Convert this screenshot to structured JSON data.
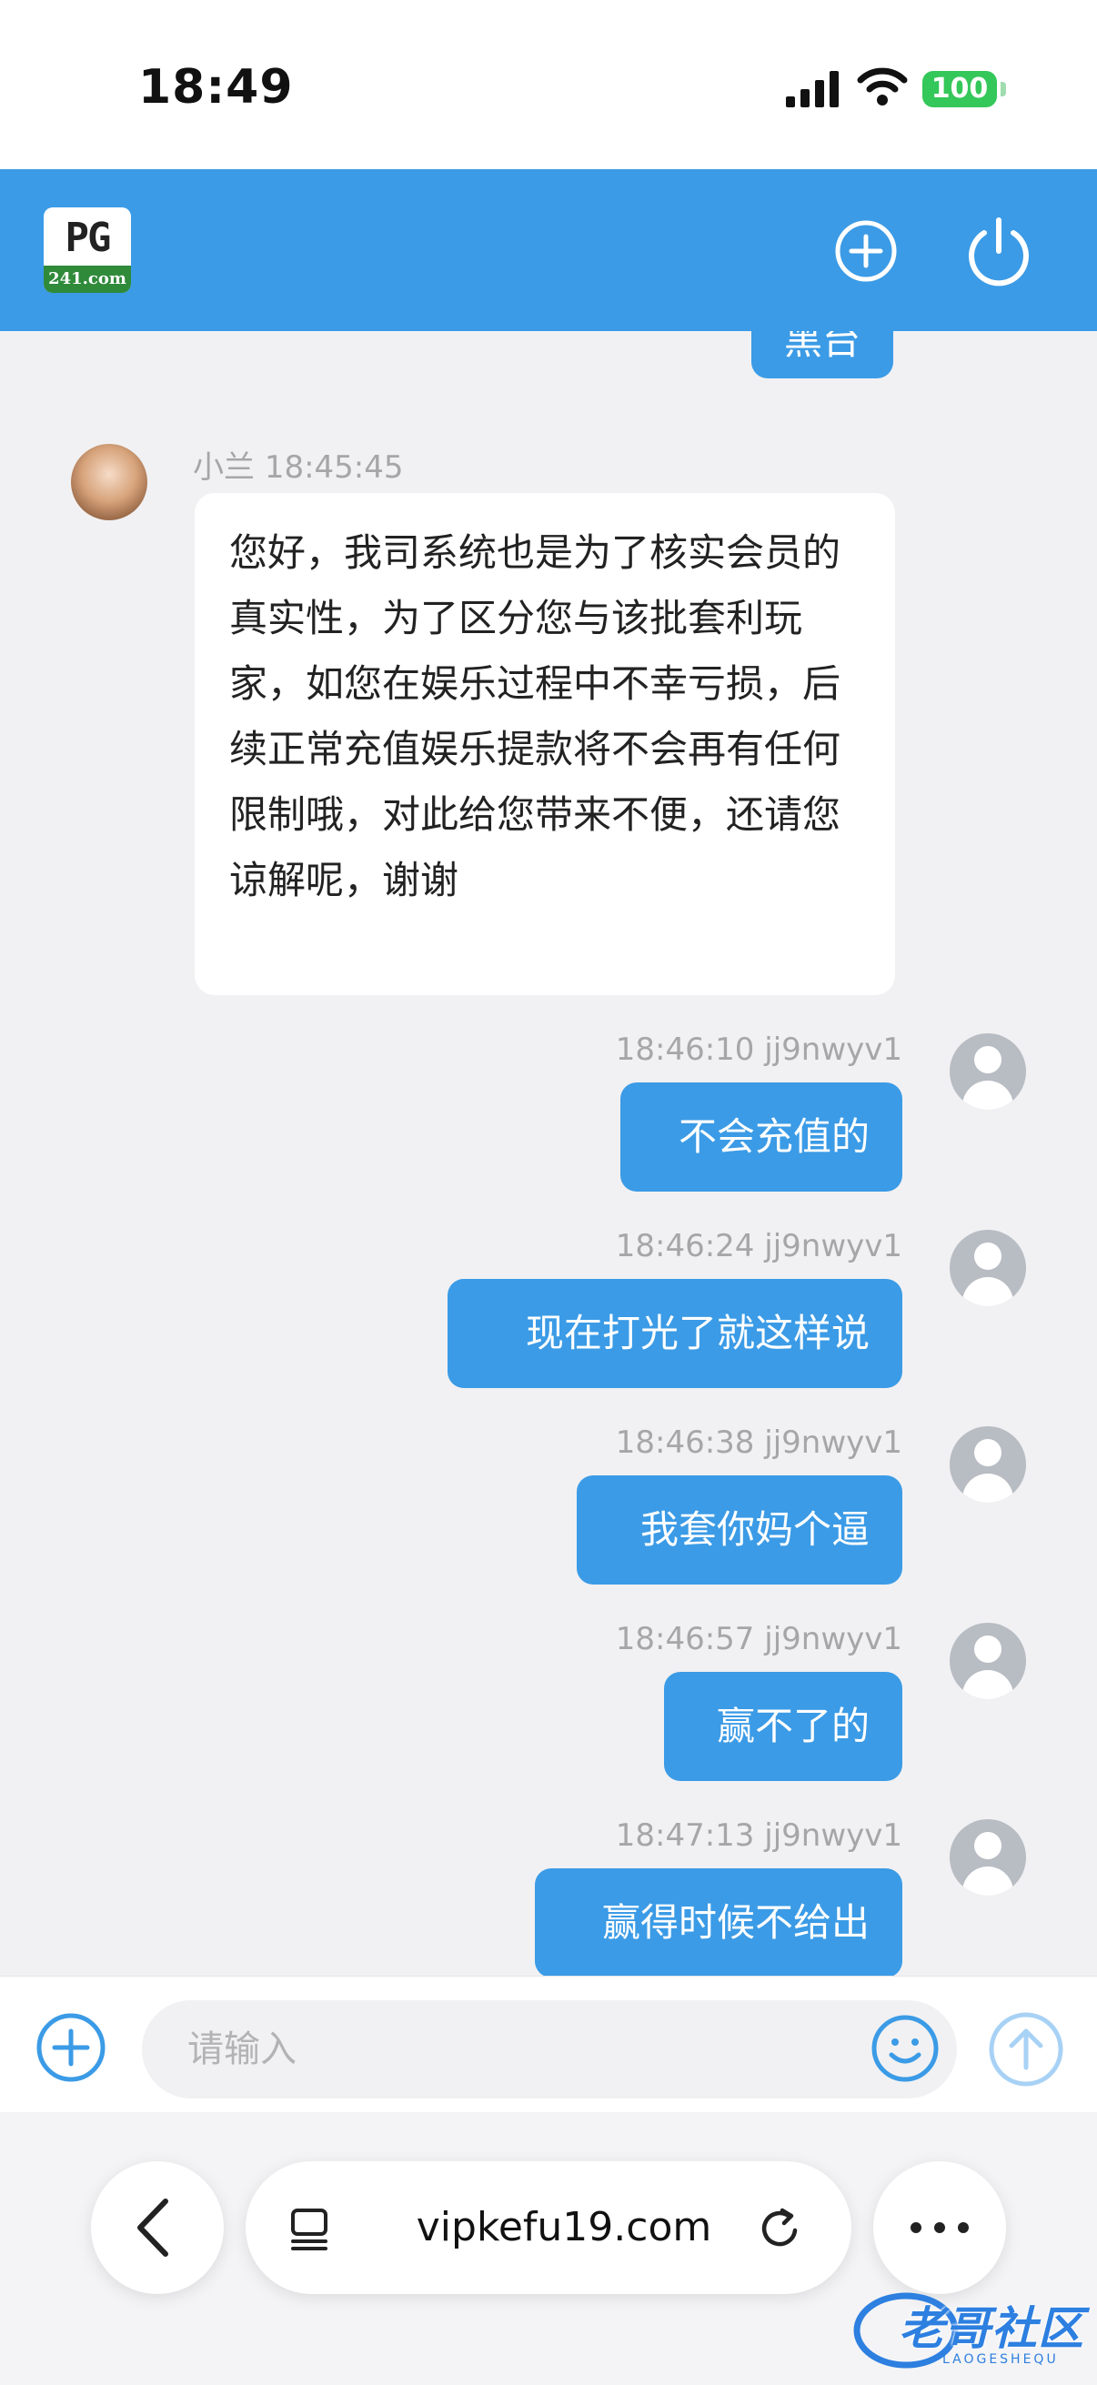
{
  "status_bar": {
    "time": "18:49",
    "battery": "100"
  },
  "messages": [
    {
      "side": "right",
      "text": "黑台"
    },
    {
      "side": "left",
      "sender": "小兰",
      "time": "18:45:45",
      "text": "您好，我司系统也是为了核实会员的真实性，为了区分您与该批套利玩家，如您在娱乐过程中不幸亏损，后续正常充值娱乐提款将不会再有任何限制哦，对此给您带来不便，还请您谅解呢，谢谢"
    },
    {
      "side": "right",
      "meta": "18:46:10 jj9nwyv1",
      "text": "不会充值的"
    },
    {
      "side": "right",
      "meta": "18:46:24 jj9nwyv1",
      "text": "现在打光了就这样说"
    },
    {
      "side": "right",
      "meta": "18:46:38 jj9nwyv1",
      "text": "我套你妈个逼"
    },
    {
      "side": "right",
      "meta": "18:46:57 jj9nwyv1",
      "text": "赢不了的"
    },
    {
      "side": "right",
      "meta": "18:47:13 jj9nwyv1",
      "text": "赢得时候不给出"
    }
  ],
  "input": {
    "placeholder": "请输入"
  },
  "browser": {
    "url": "vipkefu19.com"
  },
  "logo": {
    "main": "PG",
    "sub": "241.com"
  },
  "watermark": {
    "text": "老哥社区",
    "sub": "LAOGESHEQU"
  },
  "colors": {
    "accent": "#3b9be6",
    "background": "#f1f1f3"
  }
}
